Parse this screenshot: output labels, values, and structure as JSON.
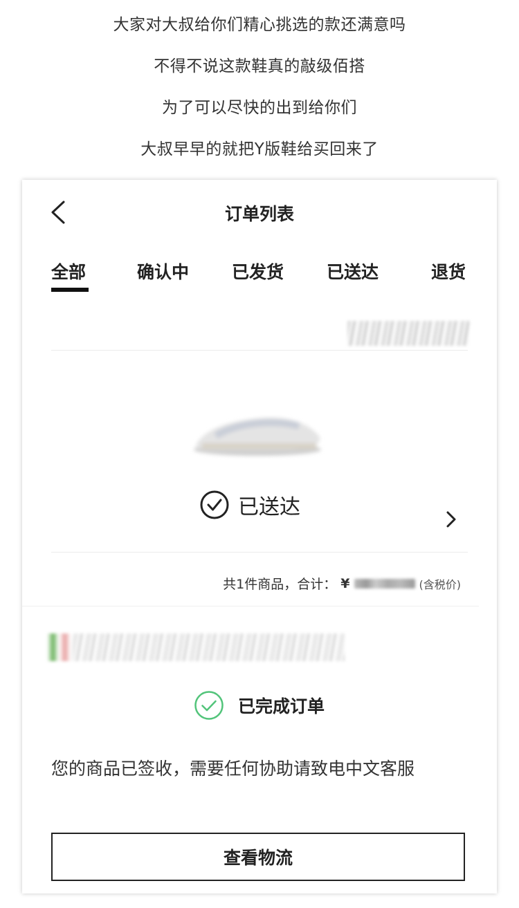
{
  "captions": [
    "大家对大叔给你们精心挑选的款还满意吗",
    "不得不说这款鞋真的敲级佰搭",
    "为了可以尽快的出到给你们",
    "大叔早早的就把Y版鞋给买回来了"
  ],
  "header": {
    "title": "订单列表",
    "back_icon": "chevron-left-icon"
  },
  "tabs": [
    {
      "label": "全部",
      "active": true
    },
    {
      "label": "确认中",
      "active": false
    },
    {
      "label": "已发货",
      "active": false
    },
    {
      "label": "已送达",
      "active": false
    },
    {
      "label": "退货",
      "active": false
    }
  ],
  "order": {
    "status": "已送达",
    "status_icon": "check-circle-icon",
    "total_prefix": "共1件商品，合计：",
    "currency": "¥",
    "tax_note": "(含税价)",
    "completed_label": "已完成订单",
    "completed_icon": "check-circle-icon",
    "completed_color": "#52c47a",
    "message": "您的商品已签收，需要任何协助请致电中文客服",
    "logistics_button": "查看物流"
  }
}
